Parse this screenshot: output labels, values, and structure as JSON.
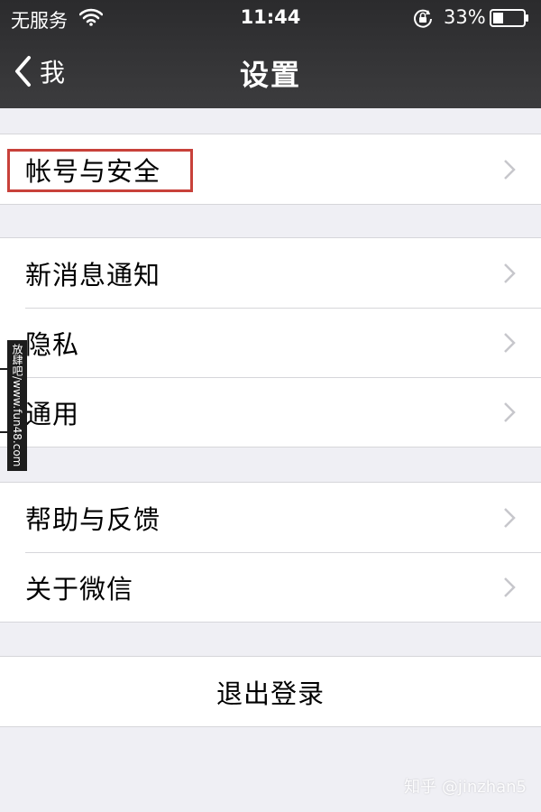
{
  "status_bar": {
    "carrier": "无服务",
    "time": "11:44",
    "battery": "33%",
    "icons": [
      "wifi-icon",
      "rotation-lock-icon",
      "battery-icon"
    ]
  },
  "nav": {
    "back_label": "我",
    "title": "设置",
    "back_icon": "chevron-left-icon"
  },
  "groups": [
    {
      "items": [
        {
          "label": "帐号与安全",
          "highlighted": true
        }
      ]
    },
    {
      "items": [
        {
          "label": "新消息通知"
        },
        {
          "label": "隐私"
        },
        {
          "label": "通用"
        }
      ]
    },
    {
      "items": [
        {
          "label": "帮助与反馈"
        },
        {
          "label": "关于微信"
        }
      ]
    }
  ],
  "logout": {
    "label": "退出登录"
  },
  "watermarks": {
    "side_strip": "放肆吧/www.fun48.com",
    "corner": "知乎 @jinzhan5"
  },
  "colors": {
    "header_bg": "#333335",
    "background": "#efeff4",
    "highlight_border": "#c8413a",
    "chevron": "#c7c7cc"
  }
}
